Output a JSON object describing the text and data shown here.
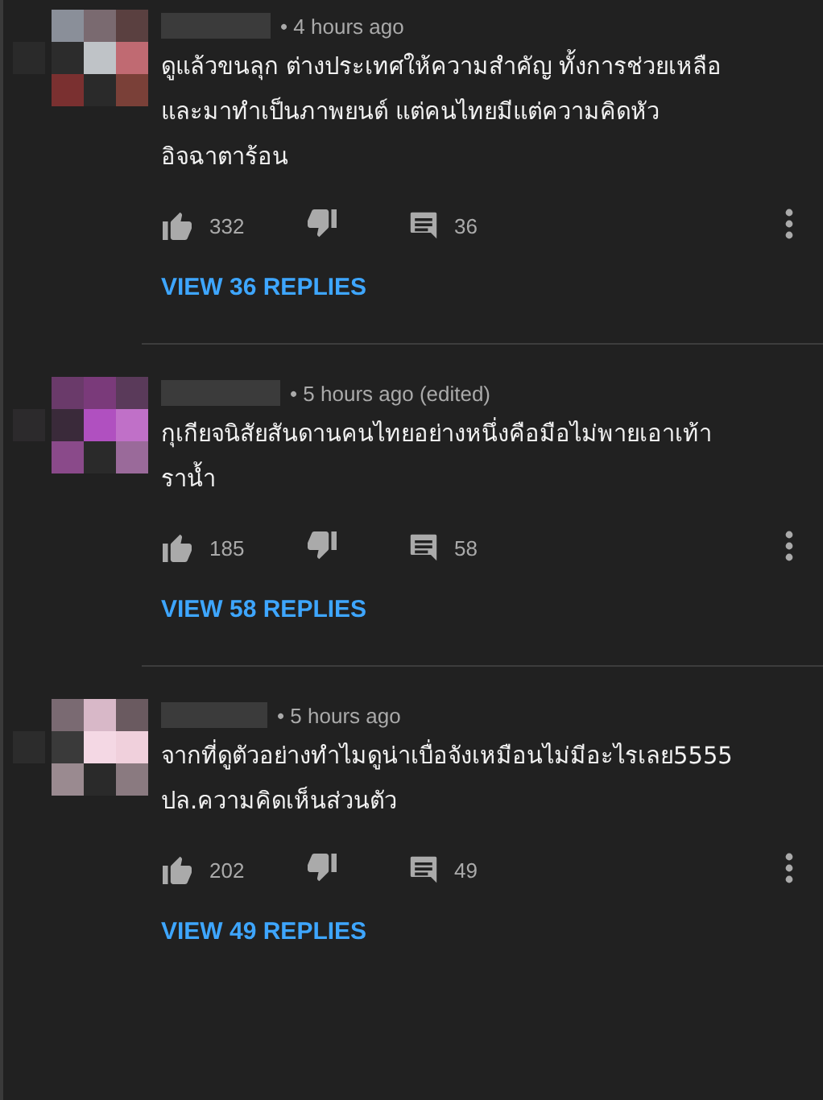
{
  "comments": [
    {
      "time": "• 4 hours ago",
      "text": "ดูแล้วขนลุก ต่างประเทศให้ความสำคัญ ทั้งการช่วยเหลือ\nและมาทำเป็นภาพยนต์ แต่คนไทยมีแต่ความคิดหัว\nอิจฉาตาร้อน",
      "likes": "332",
      "replies": "36",
      "view_replies": "VIEW 36 REPLIES"
    },
    {
      "time": "• 5 hours ago (edited)",
      "text": "กุเกียจนิสัยสันดานคนไทยอย่างหนึ่งคือมือไม่พายเอาเท้า\nราน้ำ",
      "likes": "185",
      "replies": "58",
      "view_replies": "VIEW 58 REPLIES"
    },
    {
      "time": "• 5 hours ago",
      "text": "จากที่ดูตัวอย่างทำไมดูน่าเบื่อจังเหมือนไม่มีอะไรเลย5555\nปล.ความคิดเห็นส่วนตัว",
      "likes": "202",
      "replies": "49",
      "view_replies": "VIEW 49 REPLIES"
    }
  ]
}
